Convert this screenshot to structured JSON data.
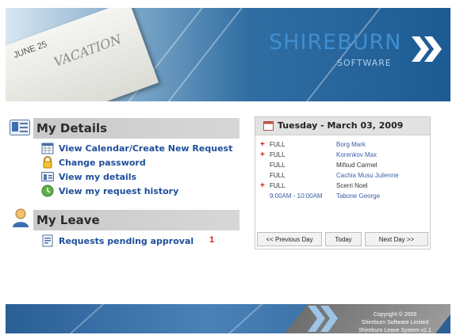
{
  "header": {
    "photo_date": "JUNE 25",
    "photo_note": "VACATION",
    "logo_main": "SHIREBURN",
    "logo_sub": "SOFTWARE"
  },
  "my_details": {
    "heading": "My Details",
    "items": [
      {
        "label": "View Calendar/Create New Request",
        "icon": "calendar-icon"
      },
      {
        "label": "Change password",
        "icon": "lock-icon"
      },
      {
        "label": "View my details",
        "icon": "id-card-icon"
      },
      {
        "label": "View my request history",
        "icon": "history-icon"
      }
    ]
  },
  "my_leave": {
    "heading": "My Leave",
    "items": [
      {
        "label": "Requests pending approval",
        "icon": "document-icon",
        "count": "1"
      }
    ]
  },
  "calendar": {
    "title": "Tuesday - March 03, 2009",
    "entries": [
      {
        "marker": "+",
        "type": "FULL",
        "name": "Borg Mark"
      },
      {
        "marker": "+",
        "type": "FULL",
        "name": "Korenkov Max"
      },
      {
        "marker": "",
        "type": "FULL",
        "name": "Mifsud Carmel"
      },
      {
        "marker": "",
        "type": "FULL",
        "name": "Cachia Musu Julienne"
      },
      {
        "marker": "+",
        "type": "FULL",
        "name": "Scerri Noel"
      },
      {
        "marker": "",
        "type": "9:00AM - 10:00AM",
        "name": "Tabone George"
      }
    ],
    "buttons": {
      "prev": "<< Previous Day",
      "today": "Today",
      "next": "Next Day >>"
    }
  },
  "footer": {
    "copyright": "Copyright © 2009",
    "company": "Shireburn Software Limited",
    "system": "Shireburn Leave System v1.1"
  },
  "colors": {
    "link": "#1f4f9a",
    "header_blue": "#1d5b94",
    "section_gray": "#cccccc",
    "pending_count": "#cc2222"
  }
}
